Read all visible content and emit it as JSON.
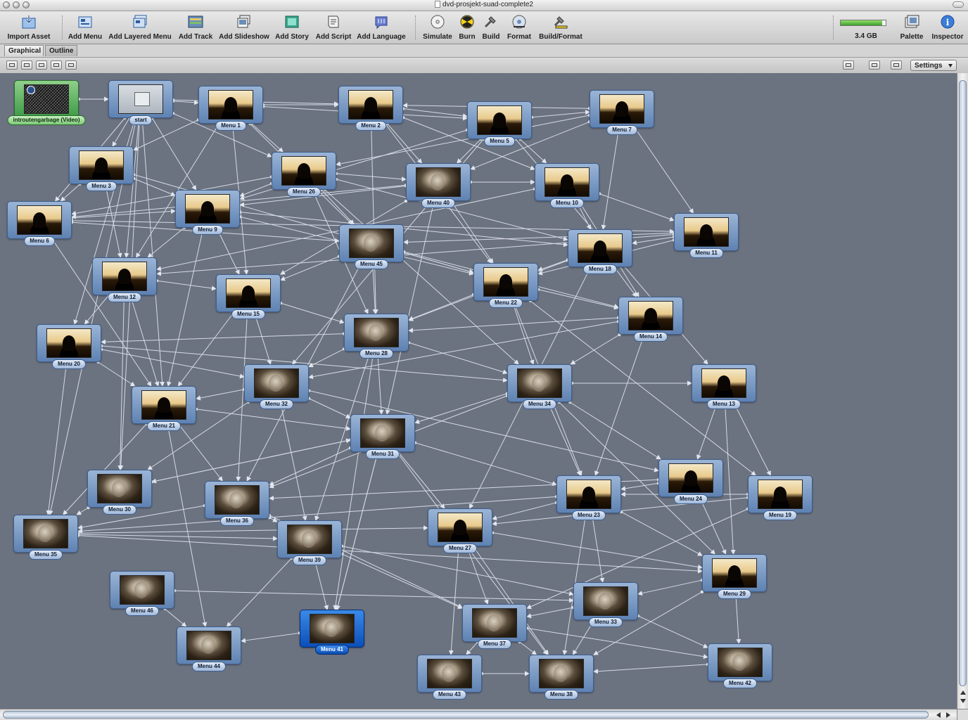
{
  "window": {
    "title": "dvd-prosjekt-suad-complete2"
  },
  "toolbar": {
    "items": [
      {
        "label": "Import Asset",
        "icon": "import-asset-icon"
      },
      {
        "label": "Add Menu",
        "icon": "add-menu-icon"
      },
      {
        "label": "Add Layered Menu",
        "icon": "add-layered-menu-icon"
      },
      {
        "label": "Add Track",
        "icon": "add-track-icon"
      },
      {
        "label": "Add Slideshow",
        "icon": "add-slideshow-icon"
      },
      {
        "label": "Add Story",
        "icon": "add-story-icon"
      },
      {
        "label": "Add Script",
        "icon": "add-script-icon"
      },
      {
        "label": "Add Language",
        "icon": "add-language-icon"
      },
      {
        "label": "Simulate",
        "icon": "simulate-icon"
      },
      {
        "label": "Burn",
        "icon": "burn-icon"
      },
      {
        "label": "Build",
        "icon": "build-icon"
      },
      {
        "label": "Format",
        "icon": "format-icon"
      },
      {
        "label": "Build/Format",
        "icon": "build-format-icon"
      },
      {
        "label": "Palette",
        "icon": "palette-icon"
      },
      {
        "label": "Inspector",
        "icon": "inspector-icon"
      }
    ],
    "disk": {
      "label": "3.4 GB",
      "fill": 0.92
    }
  },
  "tabs": [
    {
      "label": "Graphical",
      "active": true
    },
    {
      "label": "Outline",
      "active": false
    }
  ],
  "subbar": {
    "settings_label": "Settings"
  },
  "nodes": [
    {
      "id": "intro",
      "label": "introutengarbage (Video)",
      "type": "video"
    },
    {
      "id": "start",
      "label": "start",
      "type": "blank"
    },
    {
      "id": "m1",
      "label": "Menu 1",
      "type": "dark"
    },
    {
      "id": "m2",
      "label": "Menu 2",
      "type": "dark"
    },
    {
      "id": "m5",
      "label": "Menu 5",
      "type": "dark"
    },
    {
      "id": "m7",
      "label": "Menu 7",
      "type": "dark"
    },
    {
      "id": "m3",
      "label": "Menu 3",
      "type": "dark"
    },
    {
      "id": "m26",
      "label": "Menu 26",
      "type": "dark"
    },
    {
      "id": "m40",
      "label": "Menu 40",
      "type": "face"
    },
    {
      "id": "m10",
      "label": "Menu 10",
      "type": "dark"
    },
    {
      "id": "m6",
      "label": "Menu 6",
      "type": "dark"
    },
    {
      "id": "m9",
      "label": "Menu 9",
      "type": "dark"
    },
    {
      "id": "m11",
      "label": "Menu 11",
      "type": "dark"
    },
    {
      "id": "m45",
      "label": "Menu 45",
      "type": "face"
    },
    {
      "id": "m18",
      "label": "Menu 18",
      "type": "dark"
    },
    {
      "id": "m12",
      "label": "Menu 12",
      "type": "dark"
    },
    {
      "id": "m22",
      "label": "Menu 22",
      "type": "dark"
    },
    {
      "id": "m15",
      "label": "Menu 15",
      "type": "dark"
    },
    {
      "id": "m14",
      "label": "Menu 14",
      "type": "dark"
    },
    {
      "id": "m28",
      "label": "Menu 28",
      "type": "face"
    },
    {
      "id": "m20",
      "label": "Menu 20",
      "type": "dark"
    },
    {
      "id": "m32",
      "label": "Menu 32",
      "type": "face"
    },
    {
      "id": "m34",
      "label": "Menu 34",
      "type": "face"
    },
    {
      "id": "m13",
      "label": "Menu 13",
      "type": "dark"
    },
    {
      "id": "m21",
      "label": "Menu 21",
      "type": "dark"
    },
    {
      "id": "m31",
      "label": "Menu 31",
      "type": "face"
    },
    {
      "id": "m24",
      "label": "Menu 24",
      "type": "dark"
    },
    {
      "id": "m30",
      "label": "Menu 30",
      "type": "face"
    },
    {
      "id": "m36",
      "label": "Menu 36",
      "type": "face"
    },
    {
      "id": "m23",
      "label": "Menu 23",
      "type": "dark"
    },
    {
      "id": "m19",
      "label": "Menu 19",
      "type": "dark"
    },
    {
      "id": "m35",
      "label": "Menu 35",
      "type": "face"
    },
    {
      "id": "m27",
      "label": "Menu 27",
      "type": "dark"
    },
    {
      "id": "m39",
      "label": "Menu 39",
      "type": "face"
    },
    {
      "id": "m29",
      "label": "Menu 29",
      "type": "dark"
    },
    {
      "id": "m46",
      "label": "Menu 46",
      "type": "face"
    },
    {
      "id": "m33",
      "label": "Menu 33",
      "type": "face"
    },
    {
      "id": "m37",
      "label": "Menu 37",
      "type": "face"
    },
    {
      "id": "m41",
      "label": "Menu 41",
      "type": "face",
      "selected": true
    },
    {
      "id": "m44",
      "label": "Menu 44",
      "type": "face"
    },
    {
      "id": "m42",
      "label": "Menu 42",
      "type": "face"
    },
    {
      "id": "m43",
      "label": "Menu 43",
      "type": "face"
    },
    {
      "id": "m38",
      "label": "Menu 38",
      "type": "face"
    }
  ],
  "links": [
    [
      "intro",
      "start"
    ],
    [
      "start",
      "m1"
    ],
    [
      "start",
      "m2"
    ],
    [
      "start",
      "m3"
    ],
    [
      "start",
      "m6"
    ],
    [
      "start",
      "m9"
    ],
    [
      "start",
      "m12"
    ],
    [
      "start",
      "m20"
    ],
    [
      "start",
      "m21"
    ],
    [
      "start",
      "m26"
    ],
    [
      "start",
      "m35"
    ],
    [
      "start",
      "m30"
    ],
    [
      "m1",
      "m2"
    ],
    [
      "m1",
      "m3"
    ],
    [
      "m1",
      "m26"
    ],
    [
      "m1",
      "m45"
    ],
    [
      "m1",
      "m5"
    ],
    [
      "m1",
      "m15"
    ],
    [
      "m1",
      "m12"
    ],
    [
      "m2",
      "m5"
    ],
    [
      "m2",
      "m40"
    ],
    [
      "m2",
      "m10"
    ],
    [
      "m2",
      "m28"
    ],
    [
      "m2",
      "m22"
    ],
    [
      "m5",
      "m7"
    ],
    [
      "m5",
      "m10"
    ],
    [
      "m5",
      "m40"
    ],
    [
      "m5",
      "m9"
    ],
    [
      "m5",
      "m13"
    ],
    [
      "m5",
      "m32"
    ],
    [
      "m7",
      "m11"
    ],
    [
      "m7",
      "m18"
    ],
    [
      "m7",
      "m40"
    ],
    [
      "m7",
      "m26"
    ],
    [
      "m7",
      "m2"
    ],
    [
      "m3",
      "m6"
    ],
    [
      "m3",
      "m9"
    ],
    [
      "m3",
      "m12"
    ],
    [
      "m3",
      "m22"
    ],
    [
      "m26",
      "m9"
    ],
    [
      "m26",
      "m40"
    ],
    [
      "m26",
      "m45"
    ],
    [
      "m26",
      "m6"
    ],
    [
      "m26",
      "m28"
    ],
    [
      "m26",
      "m34"
    ],
    [
      "m26",
      "m18"
    ],
    [
      "m40",
      "m10"
    ],
    [
      "m40",
      "m9"
    ],
    [
      "m40",
      "m15"
    ],
    [
      "m40",
      "m22"
    ],
    [
      "m40",
      "m31"
    ],
    [
      "m40",
      "m6"
    ],
    [
      "m10",
      "m11"
    ],
    [
      "m10",
      "m18"
    ],
    [
      "m10",
      "m12"
    ],
    [
      "m10",
      "m14"
    ],
    [
      "m6",
      "m9"
    ],
    [
      "m6",
      "m21"
    ],
    [
      "m6",
      "m45"
    ],
    [
      "m6",
      "m11"
    ],
    [
      "m9",
      "m12"
    ],
    [
      "m9",
      "m15"
    ],
    [
      "m9",
      "m18"
    ],
    [
      "m9",
      "m22"
    ],
    [
      "m9",
      "m21"
    ],
    [
      "m11",
      "m18"
    ],
    [
      "m11",
      "m22"
    ],
    [
      "m11",
      "m45"
    ],
    [
      "m11",
      "m12"
    ],
    [
      "m45",
      "m28"
    ],
    [
      "m45",
      "m22"
    ],
    [
      "m45",
      "m15"
    ],
    [
      "m45",
      "m14"
    ],
    [
      "m45",
      "m36"
    ],
    [
      "m18",
      "m14"
    ],
    [
      "m18",
      "m22"
    ],
    [
      "m18",
      "m28"
    ],
    [
      "m18",
      "m27"
    ],
    [
      "m12",
      "m21"
    ],
    [
      "m12",
      "m15"
    ],
    [
      "m12",
      "m30"
    ],
    [
      "m12",
      "m20"
    ],
    [
      "m22",
      "m14"
    ],
    [
      "m22",
      "m28"
    ],
    [
      "m22",
      "m34"
    ],
    [
      "m22",
      "m23"
    ],
    [
      "m22",
      "m19"
    ],
    [
      "m15",
      "m28"
    ],
    [
      "m15",
      "m32"
    ],
    [
      "m15",
      "m21"
    ],
    [
      "m15",
      "m36"
    ],
    [
      "m14",
      "m34"
    ],
    [
      "m14",
      "m32"
    ],
    [
      "m14",
      "m23"
    ],
    [
      "m14",
      "m28"
    ],
    [
      "m28",
      "m31"
    ],
    [
      "m28",
      "m32"
    ],
    [
      "m28",
      "m34"
    ],
    [
      "m28",
      "m20"
    ],
    [
      "m28",
      "m39"
    ],
    [
      "m28",
      "m41"
    ],
    [
      "m20",
      "m21"
    ],
    [
      "m20",
      "m35"
    ],
    [
      "m20",
      "m32"
    ],
    [
      "m20",
      "m34"
    ],
    [
      "m32",
      "m31"
    ],
    [
      "m32",
      "m21"
    ],
    [
      "m32",
      "m30"
    ],
    [
      "m32",
      "m24"
    ],
    [
      "m32",
      "m39"
    ],
    [
      "m34",
      "m13"
    ],
    [
      "m34",
      "m31"
    ],
    [
      "m34",
      "m23"
    ],
    [
      "m34",
      "m24"
    ],
    [
      "m34",
      "m36"
    ],
    [
      "m34",
      "m29"
    ],
    [
      "m13",
      "m24"
    ],
    [
      "m13",
      "m29"
    ],
    [
      "m13",
      "m19"
    ],
    [
      "m21",
      "m36"
    ],
    [
      "m21",
      "m44"
    ],
    [
      "m21",
      "m35"
    ],
    [
      "m21",
      "m31"
    ],
    [
      "m31",
      "m30"
    ],
    [
      "m31",
      "m36"
    ],
    [
      "m31",
      "m27"
    ],
    [
      "m31",
      "m23"
    ],
    [
      "m31",
      "m38"
    ],
    [
      "m31",
      "m41"
    ],
    [
      "m24",
      "m23"
    ],
    [
      "m24",
      "m29"
    ],
    [
      "m24",
      "m36"
    ],
    [
      "m30",
      "m35"
    ],
    [
      "m30",
      "m31"
    ],
    [
      "m36",
      "m39"
    ],
    [
      "m36",
      "m35"
    ],
    [
      "m36",
      "m37"
    ],
    [
      "m23",
      "m27"
    ],
    [
      "m23",
      "m33"
    ],
    [
      "m23",
      "m29"
    ],
    [
      "m23",
      "m38"
    ],
    [
      "m23",
      "m35"
    ],
    [
      "m19",
      "m23"
    ],
    [
      "m19",
      "m27"
    ],
    [
      "m19",
      "m37"
    ],
    [
      "m35",
      "m39"
    ],
    [
      "m35",
      "m29"
    ],
    [
      "m35",
      "m27"
    ],
    [
      "m27",
      "m37"
    ],
    [
      "m27",
      "m29"
    ],
    [
      "m27",
      "m43"
    ],
    [
      "m27",
      "m38"
    ],
    [
      "m39",
      "m41"
    ],
    [
      "m39",
      "m44"
    ],
    [
      "m39",
      "m37"
    ],
    [
      "m39",
      "m33"
    ],
    [
      "m29",
      "m33"
    ],
    [
      "m29",
      "m38"
    ],
    [
      "m29",
      "m42"
    ],
    [
      "m46",
      "m44"
    ],
    [
      "m46",
      "m33"
    ],
    [
      "m33",
      "m37"
    ],
    [
      "m33",
      "m38"
    ],
    [
      "m33",
      "m42"
    ],
    [
      "m37",
      "m38"
    ],
    [
      "m37",
      "m43"
    ],
    [
      "m37",
      "m42"
    ],
    [
      "m41",
      "m44"
    ],
    [
      "m41",
      "m31"
    ],
    [
      "m42",
      "m38"
    ],
    [
      "m43",
      "m38"
    ]
  ]
}
